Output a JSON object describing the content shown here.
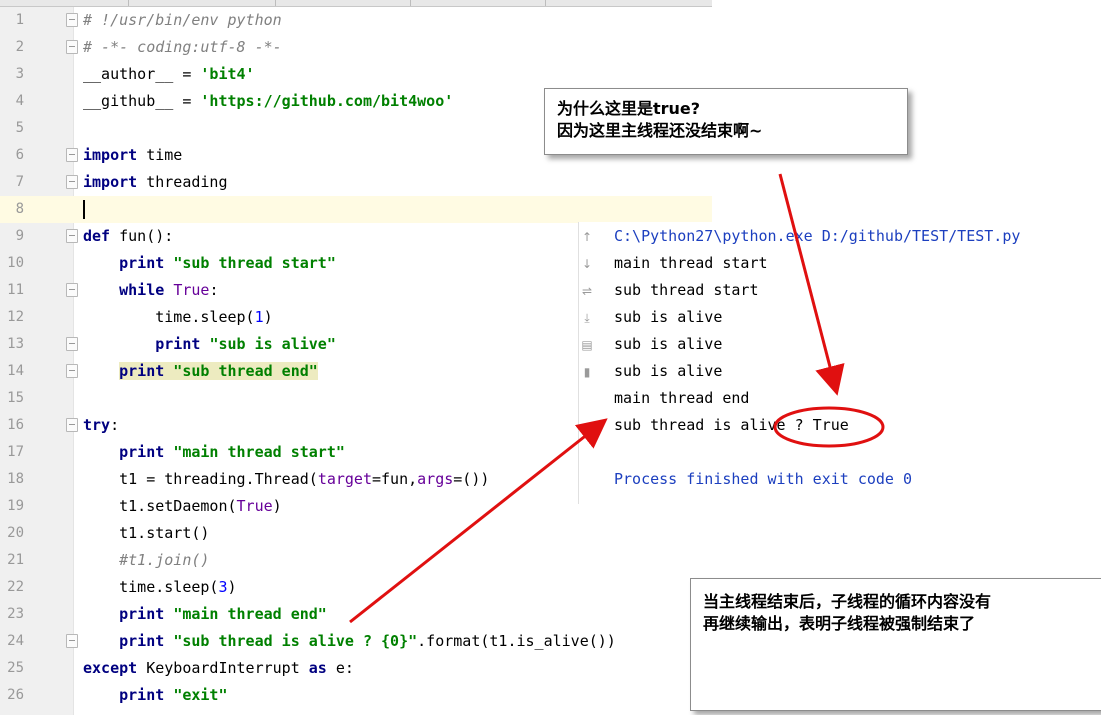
{
  "editor": {
    "lines": [
      {
        "n": "1",
        "fold": true,
        "segs": [
          {
            "t": "# !/usr/bin/env python",
            "c": "cmt"
          }
        ]
      },
      {
        "n": "2",
        "fold": true,
        "segs": [
          {
            "t": "# -*- coding:utf-8 -*-",
            "c": "cmt"
          }
        ]
      },
      {
        "n": "3",
        "segs": [
          {
            "t": "__author__ = "
          },
          {
            "t": "'bit4'",
            "c": "str"
          }
        ]
      },
      {
        "n": "4",
        "segs": [
          {
            "t": "__github__ = "
          },
          {
            "t": "'https://github.com/bit4woo'",
            "c": "str"
          }
        ]
      },
      {
        "n": "5",
        "segs": []
      },
      {
        "n": "6",
        "fold": true,
        "segs": [
          {
            "t": "import",
            "c": "kw"
          },
          {
            "t": " time"
          }
        ]
      },
      {
        "n": "7",
        "fold": true,
        "segs": [
          {
            "t": "import",
            "c": "kw"
          },
          {
            "t": " threading"
          }
        ]
      },
      {
        "n": "8",
        "current": true,
        "segs": []
      },
      {
        "n": "9",
        "fold": true,
        "segs": [
          {
            "t": "def",
            "c": "kw"
          },
          {
            "t": " fun():"
          }
        ]
      },
      {
        "n": "10",
        "segs": [
          {
            "t": "    "
          },
          {
            "t": "print",
            "c": "kw"
          },
          {
            "t": " "
          },
          {
            "t": "\"sub thread start\"",
            "c": "str"
          }
        ]
      },
      {
        "n": "11",
        "fold": true,
        "segs": [
          {
            "t": "    "
          },
          {
            "t": "while",
            "c": "kw"
          },
          {
            "t": " "
          },
          {
            "t": "True",
            "c": "param"
          },
          {
            "t": ":"
          }
        ]
      },
      {
        "n": "12",
        "segs": [
          {
            "t": "        time.sleep("
          },
          {
            "t": "1",
            "c": "num"
          },
          {
            "t": ")"
          }
        ]
      },
      {
        "n": "13",
        "fold": true,
        "segs": [
          {
            "t": "        "
          },
          {
            "t": "print",
            "c": "kw"
          },
          {
            "t": " "
          },
          {
            "t": "\"sub is alive\"",
            "c": "str"
          }
        ]
      },
      {
        "n": "14",
        "fold": true,
        "segs": [
          {
            "t": "    "
          },
          {
            "t": "print \"sub thread end\"",
            "c": "hlstr"
          }
        ]
      },
      {
        "n": "15",
        "segs": []
      },
      {
        "n": "16",
        "fold": true,
        "segs": [
          {
            "t": "try",
            "c": "kw"
          },
          {
            "t": ":"
          }
        ]
      },
      {
        "n": "17",
        "segs": [
          {
            "t": "    "
          },
          {
            "t": "print",
            "c": "kw"
          },
          {
            "t": " "
          },
          {
            "t": "\"main thread start\"",
            "c": "str"
          }
        ]
      },
      {
        "n": "18",
        "segs": [
          {
            "t": "    t1 = threading.Thread("
          },
          {
            "t": "target",
            "c": "param"
          },
          {
            "t": "=fun,"
          },
          {
            "t": "args",
            "c": "param"
          },
          {
            "t": "=())"
          }
        ]
      },
      {
        "n": "19",
        "segs": [
          {
            "t": "    t1.setDaemon("
          },
          {
            "t": "True",
            "c": "param"
          },
          {
            "t": ")"
          }
        ]
      },
      {
        "n": "20",
        "segs": [
          {
            "t": "    t1.start()"
          }
        ]
      },
      {
        "n": "21",
        "segs": [
          {
            "t": "    "
          },
          {
            "t": "#t1.join()",
            "c": "cmt"
          }
        ]
      },
      {
        "n": "22",
        "segs": [
          {
            "t": "    time.sleep("
          },
          {
            "t": "3",
            "c": "num"
          },
          {
            "t": ")"
          }
        ]
      },
      {
        "n": "23",
        "segs": [
          {
            "t": "    "
          },
          {
            "t": "print",
            "c": "kw"
          },
          {
            "t": " "
          },
          {
            "t": "\"main thread end\"",
            "c": "str"
          }
        ]
      },
      {
        "n": "24",
        "fold": true,
        "segs": [
          {
            "t": "    "
          },
          {
            "t": "print",
            "c": "kw"
          },
          {
            "t": " "
          },
          {
            "t": "\"sub thread is alive ? {0}\"",
            "c": "str"
          },
          {
            "t": ".format(t1.is_alive())"
          }
        ]
      },
      {
        "n": "25",
        "segs": [
          {
            "t": "except",
            "c": "kw"
          },
          {
            "t": " KeyboardInterrupt "
          },
          {
            "t": "as",
            "c": "kw"
          },
          {
            "t": " e:"
          }
        ]
      },
      {
        "n": "26",
        "segs": [
          {
            "t": "    "
          },
          {
            "t": "print",
            "c": "kw"
          },
          {
            "t": " "
          },
          {
            "t": "\"exit\"",
            "c": "str"
          }
        ]
      }
    ]
  },
  "console": {
    "lines": [
      {
        "text": "C:\\Python27\\python.exe D:/github/TEST/TEST.py",
        "kind": "sys"
      },
      {
        "text": "main thread start",
        "kind": "out"
      },
      {
        "text": "sub thread start",
        "kind": "out"
      },
      {
        "text": "sub is alive",
        "kind": "out"
      },
      {
        "text": "sub is alive",
        "kind": "out"
      },
      {
        "text": "sub is alive",
        "kind": "out"
      },
      {
        "text": "main thread end",
        "kind": "out"
      },
      {
        "text": "sub thread is alive ? True",
        "kind": "out"
      },
      {
        "text": "",
        "kind": "out"
      },
      {
        "text": "Process finished with exit code 0",
        "kind": "sys"
      }
    ],
    "toolbar_icons": [
      "arrow-up-icon",
      "arrow-down-icon",
      "soft-wrap-icon",
      "scroll-to-end-icon",
      "print-icon",
      "trash-icon"
    ]
  },
  "annotations": {
    "top_note": {
      "line1": "为什么这里是true?",
      "line2": "因为这里主线程还没结束啊~"
    },
    "bottom_note": {
      "line1": "当主线程结束后，子线程的循环内容没有",
      "line2": "再继续输出，表明子线程被强制结束了"
    }
  },
  "colors": {
    "arrow": "#e01010",
    "keyword": "#000080",
    "string": "#008000",
    "comment": "#808080",
    "console_system": "#1c3fbf"
  }
}
